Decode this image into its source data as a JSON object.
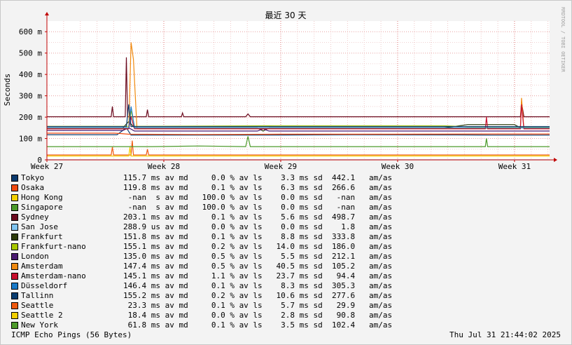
{
  "chart_data": {
    "type": "line",
    "title": "最近 30 天",
    "ylabel": "Seconds",
    "xlabel": "",
    "ylim": [
      0,
      650
    ],
    "y_ticks": [
      {
        "value": 0,
        "label": "0"
      },
      {
        "value": 100,
        "label": "100 m"
      },
      {
        "value": 200,
        "label": "200 m"
      },
      {
        "value": 300,
        "label": "300 m"
      },
      {
        "value": 400,
        "label": "400 m"
      },
      {
        "value": 500,
        "label": "500 m"
      },
      {
        "value": 600,
        "label": "600 m"
      }
    ],
    "x_ticks": [
      "Week 27",
      "Week 28",
      "Week 29",
      "Week 30",
      "Week 31"
    ],
    "x_range_weeks": [
      0,
      4.3
    ],
    "grid": true,
    "watermark": "RRDTOOL / TOBI OETIKER",
    "series": [
      {
        "name": "Tokyo",
        "color": "#0b3a6e",
        "baseline": 115.7,
        "stats": "115.7 ms av md     0.0 % av ls    3.3 ms sd  442.1   am/as",
        "points": [
          [
            0,
            118
          ],
          [
            0.6,
            118
          ],
          [
            0.68,
            150
          ],
          [
            0.72,
            116
          ],
          [
            1.2,
            116
          ],
          [
            1.9,
            116
          ],
          [
            2.6,
            118
          ],
          [
            3.5,
            117
          ],
          [
            3.8,
            116
          ],
          [
            4.3,
            116
          ]
        ]
      },
      {
        "name": "Osaka",
        "color": "#f04a10",
        "baseline": 119.8,
        "stats": "119.8 ms av md     0.1 % av ls    6.3 ms sd  266.6   am/as",
        "points": [
          [
            0,
            125
          ],
          [
            0.58,
            125
          ],
          [
            0.7,
            120
          ],
          [
            1.3,
            119
          ],
          [
            2.0,
            120
          ],
          [
            3.0,
            120
          ],
          [
            3.8,
            121
          ],
          [
            4.3,
            121
          ]
        ]
      },
      {
        "name": "Hong Kong",
        "color": "#f3d000",
        "baseline": null,
        "stats": " -nan  s av md   100.0 % av ls    0.0 ms sd   -nan   am/as",
        "points": []
      },
      {
        "name": "Singapore",
        "color": "#4c9a2a",
        "baseline": null,
        "stats": " -nan  s av md   100.0 % av ls    0.0 ms sd   -nan   am/as",
        "points": []
      },
      {
        "name": "Sydney",
        "color": "#6b0a1e",
        "baseline": 203.1,
        "stats": "203.1 ms av md     0.1 % av ls    5.6 ms sd  498.7   am/as",
        "points": [
          [
            0,
            202
          ],
          [
            0.55,
            202
          ],
          [
            0.56,
            250
          ],
          [
            0.57,
            202
          ],
          [
            0.67,
            202
          ],
          [
            0.68,
            480
          ],
          [
            0.69,
            202
          ],
          [
            0.85,
            202
          ],
          [
            0.86,
            235
          ],
          [
            0.87,
            202
          ],
          [
            1.15,
            202
          ],
          [
            1.16,
            220
          ],
          [
            1.17,
            202
          ],
          [
            1.7,
            202
          ],
          [
            1.72,
            215
          ],
          [
            1.74,
            202
          ],
          [
            3.2,
            202
          ],
          [
            3.9,
            202
          ],
          [
            4.05,
            202
          ],
          [
            4.06,
            270
          ],
          [
            4.08,
            202
          ],
          [
            4.3,
            202
          ]
        ]
      },
      {
        "name": "San Jose",
        "color": "#7fc4f0",
        "baseline": 288.9,
        "stats": "288.9 us av md     0.0 % av ls    0.0 ms sd    1.8   am/as",
        "points": [
          [
            0,
            0.3
          ],
          [
            4.3,
            0.3
          ]
        ]
      },
      {
        "name": "Frankfurt",
        "color": "#2c3a0a",
        "baseline": 151.8,
        "stats": "151.8 ms av md     0.1 % av ls    8.8 ms sd  333.8   am/as",
        "points": [
          [
            0,
            150
          ],
          [
            0.65,
            150
          ],
          [
            0.7,
            180
          ],
          [
            0.75,
            150
          ],
          [
            1.8,
            150
          ],
          [
            1.85,
            135
          ],
          [
            1.9,
            150
          ],
          [
            3.4,
            150
          ],
          [
            3.6,
            165
          ],
          [
            4.0,
            165
          ],
          [
            4.05,
            150
          ],
          [
            4.3,
            150
          ]
        ]
      },
      {
        "name": "Frankfurt-nano",
        "color": "#a8c800",
        "baseline": 155.1,
        "stats": "155.1 ms av md     0.2 % av ls   14.0 ms sd  186.0   am/as",
        "points": [
          [
            0,
            157
          ],
          [
            0.7,
            157
          ],
          [
            0.72,
            230
          ],
          [
            0.75,
            157
          ],
          [
            1.95,
            160
          ],
          [
            3.4,
            160
          ],
          [
            3.6,
            155
          ],
          [
            4.3,
            155
          ]
        ]
      },
      {
        "name": "London",
        "color": "#4a1a70",
        "baseline": 135.0,
        "stats": "135.0 ms av md     0.5 % av ls    5.5 ms sd  212.1   am/as",
        "points": [
          [
            0,
            138
          ],
          [
            0.65,
            138
          ],
          [
            0.7,
            150
          ],
          [
            0.75,
            135
          ],
          [
            1.8,
            135
          ],
          [
            1.85,
            145
          ],
          [
            1.9,
            135
          ],
          [
            4.3,
            135
          ]
        ]
      },
      {
        "name": "Amsterdam",
        "color": "#f08a10",
        "baseline": 147.4,
        "stats": "147.4 ms av md     0.5 % av ls   40.5 ms sd  105.2   am/as",
        "points": [
          [
            0,
            148
          ],
          [
            0.7,
            148
          ],
          [
            0.72,
            550
          ],
          [
            0.74,
            470
          ],
          [
            0.77,
            148
          ],
          [
            3.9,
            148
          ],
          [
            4.05,
            148
          ],
          [
            4.06,
            290
          ],
          [
            4.08,
            148
          ],
          [
            4.3,
            148
          ]
        ]
      },
      {
        "name": "Amsterdam-nano",
        "color": "#c8102e",
        "baseline": 145.1,
        "stats": "145.1 ms av md     1.1 % av ls   23.7 ms sd   94.4   am/as",
        "points": [
          [
            0,
            145
          ],
          [
            0.7,
            145
          ],
          [
            0.72,
            200
          ],
          [
            0.75,
            145
          ],
          [
            3.75,
            145
          ],
          [
            3.76,
            200
          ],
          [
            3.77,
            145
          ],
          [
            4.05,
            145
          ],
          [
            4.06,
            260
          ],
          [
            4.08,
            145
          ],
          [
            4.3,
            145
          ]
        ]
      },
      {
        "name": "Düsseldorf",
        "color": "#1a7ac8",
        "baseline": 146.4,
        "stats": "146.4 ms av md     0.1 % av ls    8.3 ms sd  305.3   am/as",
        "points": [
          [
            0,
            150
          ],
          [
            0.7,
            150
          ],
          [
            0.72,
            250
          ],
          [
            0.75,
            150
          ],
          [
            4.3,
            150
          ]
        ]
      },
      {
        "name": "Tallinn",
        "color": "#0a3d70",
        "baseline": 155.2,
        "stats": "155.2 ms av md     0.2 % av ls   10.6 ms sd  277.6   am/as",
        "points": [
          [
            0,
            156
          ],
          [
            0.68,
            156
          ],
          [
            0.7,
            260
          ],
          [
            0.72,
            156
          ],
          [
            4.3,
            156
          ]
        ]
      },
      {
        "name": "Seattle",
        "color": "#f05a10",
        "baseline": 23.3,
        "stats": " 23.3 ms av md     0.1 % av ls    5.7 ms sd   29.9   am/as",
        "points": [
          [
            0,
            23
          ],
          [
            0.55,
            23
          ],
          [
            0.56,
            60
          ],
          [
            0.57,
            23
          ],
          [
            0.72,
            23
          ],
          [
            0.73,
            90
          ],
          [
            0.74,
            23
          ],
          [
            0.85,
            23
          ],
          [
            0.86,
            50
          ],
          [
            0.87,
            23
          ],
          [
            4.3,
            23
          ]
        ]
      },
      {
        "name": "Seattle 2",
        "color": "#f3d000",
        "baseline": 18.4,
        "stats": " 18.4 ms av md     0.0 % av ls    2.8 ms sd   90.8   am/as",
        "points": [
          [
            0,
            18
          ],
          [
            0.7,
            18
          ],
          [
            0.71,
            60
          ],
          [
            0.72,
            18
          ],
          [
            4.3,
            18
          ]
        ]
      },
      {
        "name": "New York",
        "color": "#4c9a2a",
        "baseline": 61.8,
        "stats": " 61.8 ms av md     0.1 % av ls    3.5 ms sd  102.4   am/as",
        "points": [
          [
            0,
            62
          ],
          [
            0.9,
            62
          ],
          [
            1.3,
            65
          ],
          [
            1.7,
            62
          ],
          [
            1.72,
            110
          ],
          [
            1.74,
            62
          ],
          [
            2.4,
            62
          ],
          [
            3.75,
            62
          ],
          [
            3.76,
            100
          ],
          [
            3.77,
            62
          ],
          [
            4.3,
            62
          ]
        ]
      }
    ]
  },
  "footer": {
    "left": "ICMP Echo Pings (56 Bytes)",
    "right": "Thu Jul 31 21:44:02 2025"
  }
}
